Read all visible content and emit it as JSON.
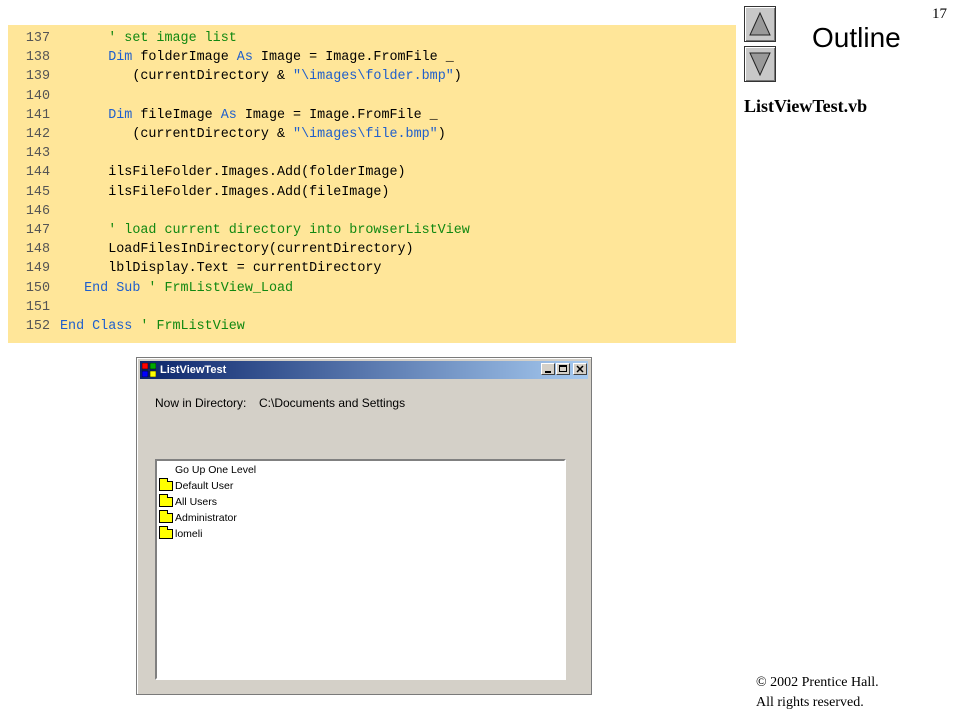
{
  "slide": {
    "page_number": "17",
    "outline_label": "Outline",
    "file_title": "ListViewTest.vb",
    "copyright_line1": "© 2002 Prentice Hall.",
    "copyright_line2": "All rights reserved."
  },
  "code": {
    "lines": [
      {
        "n": "137",
        "indent": "      ",
        "parts": [
          {
            "t": "' set image list",
            "c": "cm"
          }
        ]
      },
      {
        "n": "138",
        "indent": "      ",
        "parts": [
          {
            "t": "Dim",
            "c": "kw"
          },
          {
            "t": " folderImage ",
            "c": ""
          },
          {
            "t": "As",
            "c": "kw"
          },
          {
            "t": " Image = Image.FromFile _",
            "c": ""
          }
        ]
      },
      {
        "n": "139",
        "indent": "         ",
        "parts": [
          {
            "t": "(currentDirectory & ",
            "c": ""
          },
          {
            "t": "\"\\images\\folder.bmp\"",
            "c": "st"
          },
          {
            "t": ")",
            "c": ""
          }
        ]
      },
      {
        "n": "140",
        "indent": "",
        "parts": []
      },
      {
        "n": "141",
        "indent": "      ",
        "parts": [
          {
            "t": "Dim",
            "c": "kw"
          },
          {
            "t": " fileImage ",
            "c": ""
          },
          {
            "t": "As",
            "c": "kw"
          },
          {
            "t": " Image = Image.FromFile _",
            "c": ""
          }
        ]
      },
      {
        "n": "142",
        "indent": "         ",
        "parts": [
          {
            "t": "(currentDirectory & ",
            "c": ""
          },
          {
            "t": "\"\\images\\file.bmp\"",
            "c": "st"
          },
          {
            "t": ")",
            "c": ""
          }
        ]
      },
      {
        "n": "143",
        "indent": "",
        "parts": []
      },
      {
        "n": "144",
        "indent": "      ",
        "parts": [
          {
            "t": "ilsFileFolder.Images.Add(folderImage)",
            "c": ""
          }
        ]
      },
      {
        "n": "145",
        "indent": "      ",
        "parts": [
          {
            "t": "ilsFileFolder.Images.Add(fileImage)",
            "c": ""
          }
        ]
      },
      {
        "n": "146",
        "indent": "",
        "parts": []
      },
      {
        "n": "147",
        "indent": "      ",
        "parts": [
          {
            "t": "' load current directory into browserListView",
            "c": "cm"
          }
        ]
      },
      {
        "n": "148",
        "indent": "      ",
        "parts": [
          {
            "t": "LoadFilesInDirectory(currentDirectory)",
            "c": ""
          }
        ]
      },
      {
        "n": "149",
        "indent": "      ",
        "parts": [
          {
            "t": "lblDisplay.Text = currentDirectory",
            "c": ""
          }
        ]
      },
      {
        "n": "150",
        "indent": "   ",
        "parts": [
          {
            "t": "End Sub",
            "c": "kw"
          },
          {
            "t": " ",
            "c": ""
          },
          {
            "t": "' FrmListView_Load",
            "c": "cm"
          }
        ]
      },
      {
        "n": "151",
        "indent": "",
        "parts": []
      },
      {
        "n": "152",
        "indent": "",
        "parts": [
          {
            "t": "End Class",
            "c": "kw"
          },
          {
            "t": " ",
            "c": ""
          },
          {
            "t": "' FrmListView",
            "c": "cm"
          }
        ]
      }
    ]
  },
  "window": {
    "title": "ListViewTest",
    "directory_label": "Now in Directory:",
    "directory_value": "C:\\Documents and Settings",
    "items": [
      {
        "label": "Go Up One Level",
        "icon": "none"
      },
      {
        "label": "Default User",
        "icon": "folder-icon"
      },
      {
        "label": "All Users",
        "icon": "folder-icon"
      },
      {
        "label": "Administrator",
        "icon": "folder-icon"
      },
      {
        "label": "lomeli",
        "icon": "folder-icon"
      }
    ]
  },
  "colors": {
    "code_bg": "#ffe699",
    "keyword": "#1f5fcc",
    "comment": "#118811",
    "titlebar_start": "#0a246a",
    "titlebar_end": "#a6caf0",
    "folder": "#ffff00"
  }
}
